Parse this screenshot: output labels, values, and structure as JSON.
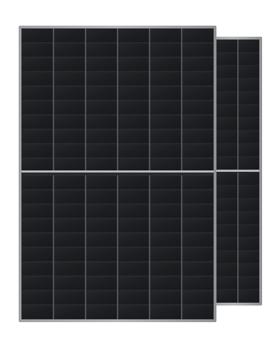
{
  "scene": {
    "subject": "solar-panel-product-photo",
    "panels": [
      {
        "role": "back",
        "half_cut": true,
        "visible_columns": 2,
        "rows_per_half": 10
      },
      {
        "role": "front",
        "half_cut": true,
        "columns": 6,
        "rows_per_half": 10
      }
    ]
  },
  "colors": {
    "background": "#ffffff",
    "frame": "#a9acaf",
    "frame_dark": "#7d8083",
    "cell": "#1e1f22",
    "cell_highlight": "#2a2b2f",
    "grid_line": "#8d9094",
    "center_split": "#b9bcbf"
  }
}
